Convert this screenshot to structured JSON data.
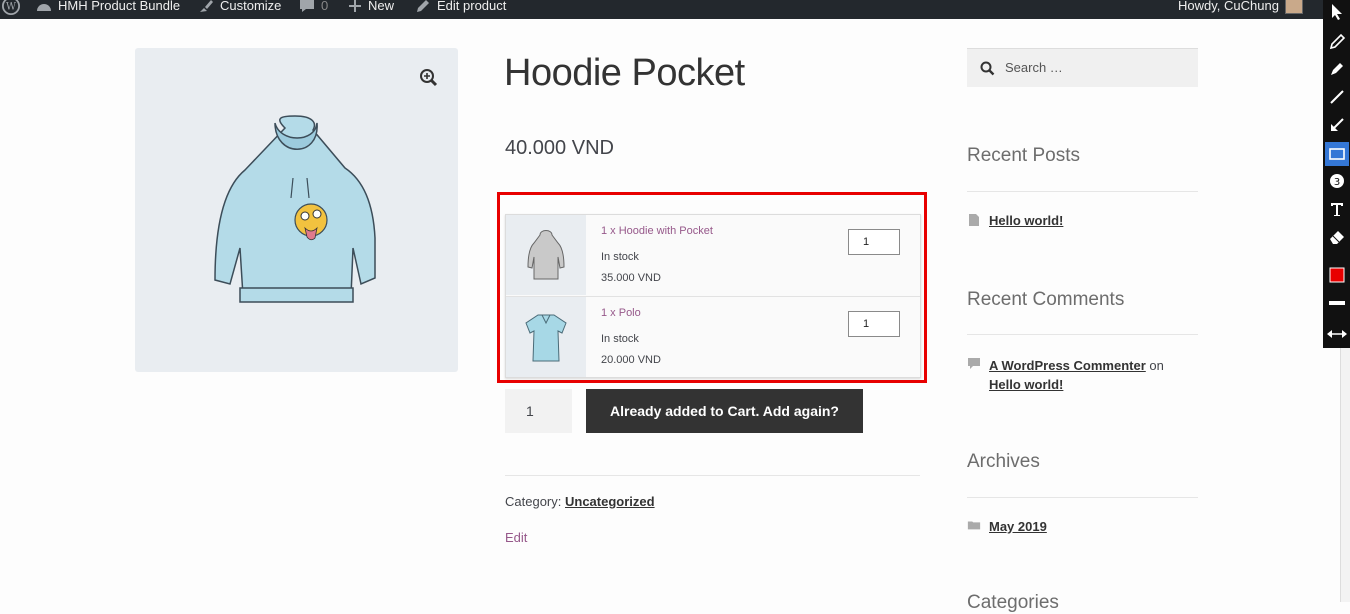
{
  "adminbar": {
    "site_name": "HMH Product Bundle",
    "customize": "Customize",
    "comments_count": "0",
    "new_label": "New",
    "edit_product": "Edit product",
    "howdy": "Howdy, CuChung"
  },
  "product": {
    "title": "Hoodie Pocket",
    "price": "40.000 VND",
    "bundle": [
      {
        "name": "1 x Hoodie with Pocket",
        "stock": "In stock",
        "price": "35.000 VND",
        "qty": "1"
      },
      {
        "name": "1 x Polo",
        "stock": "In stock",
        "price": "20.000 VND",
        "qty": "1"
      }
    ],
    "qty": "1",
    "add_button": "Already added to Cart. Add again?",
    "category_label": "Category:",
    "category": "Uncategorized",
    "edit": "Edit"
  },
  "sidebar": {
    "search_placeholder": "Search …",
    "recent_posts_title": "Recent Posts",
    "recent_post": "Hello world!",
    "recent_comments_title": "Recent Comments",
    "comment_author": "A WordPress Commenter",
    "comment_on": "on",
    "comment_post": "Hello world!",
    "archives_title": "Archives",
    "archive_item": "May 2019",
    "categories_title": "Categories"
  },
  "colors": {
    "highlight": "#e80000",
    "button": "#333333",
    "link_purple": "#96588a",
    "toolbar_selected": "#3477d6"
  }
}
